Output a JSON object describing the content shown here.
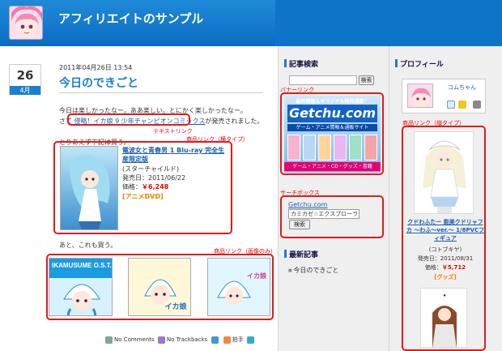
{
  "header": {
    "site_title": "アフィリエイトのサンプル"
  },
  "post": {
    "day": "26",
    "month": "4月",
    "datetime": "2011年04月26日 13:54",
    "title": "今日のできごと",
    "para1_line1": "今日は楽しかったなー。ああ楽しい。とにかく楽しかったなー。",
    "para1_prefix": "さて",
    "para1_link": "侵略！イカ娘 9 少年チャンピオンコミックス",
    "para1_suffix": "が発売されました。",
    "text_link_note": "テキストリンク",
    "buy_line": "とりあえず下記は買う。",
    "product_note": "商品リンク（横タイプ）",
    "product": {
      "title": "電波女と青春男 1 Blu-ray 完全生産限定版",
      "maker": "(スターチャイルド)",
      "release": "発売日：2011/06/22",
      "price_label": "価格：",
      "price": "￥6,248",
      "category": "[アニメDVD]"
    },
    "also_line": "あと、これも買う。",
    "image_note": "商品リンク（画像のみ）",
    "image_covers": [
      "IKAMUSUME O.S.T.",
      "イカ娘",
      "イカ娘"
    ],
    "footer": {
      "comments": "No Comments",
      "trackbacks": "No Trackbacks",
      "clap": "拍手"
    }
  },
  "sidebar_mid": {
    "search_head": "記事検索",
    "search_button": "検索",
    "banner_note": "バナーリンク",
    "banner": {
      "top": "最新情報＆オリジナル特典満載！",
      "logo": "Getchu.com",
      "sub": "ゲーム・アニメ情報＆通販サイト",
      "strip": "ゲーム・アニメ・CD・グッズ・書籍"
    },
    "searchbox_note": "サーチボックス",
    "searchbox_link": "Getchu.com",
    "searchbox_select": "カミカゼ☆エクスプローラー",
    "searchbox_button": "検索",
    "recent_head": "最新記事",
    "recent_items": [
      "今日のできごと"
    ]
  },
  "sidebar_right": {
    "profile_head": "プロフィール",
    "profile_name": "コムちゃん",
    "vertical_note": "商品リンク（縦タイプ）",
    "product": {
      "title": "クドわふたー 能美クドリャフカ ～わふ～ver.～ 1/8PVCフィギュア",
      "maker": "(コトブキヤ)",
      "release": "発売日：2011/08/31",
      "price_label": "価格：",
      "price": "￥5,712",
      "category": "[グッズ]"
    }
  },
  "colors": {
    "header_blue": "#0e74c8",
    "accent_blue": "#1a7fd0",
    "annotation_red": "#e31a1a",
    "price_red": "#ee0000"
  }
}
